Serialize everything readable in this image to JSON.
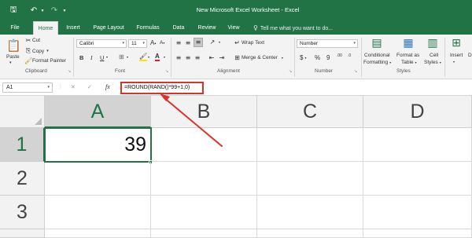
{
  "titlebar": {
    "title": "New Microsoft Excel Worksheet - Excel",
    "qat_icons": [
      "save-icon",
      "undo-icon",
      "redo-icon",
      "customize-icon"
    ]
  },
  "tabs": [
    "File",
    "Home",
    "Insert",
    "Page Layout",
    "Formulas",
    "Data",
    "Review",
    "View"
  ],
  "active_tab": "Home",
  "tell_me": "Tell me what you want to do...",
  "ribbon": {
    "clipboard": {
      "paste": "Paste",
      "cut": "Cut",
      "copy": "Copy",
      "format_painter": "Format Painter",
      "group": "Clipboard"
    },
    "font": {
      "font_name": "Calibri",
      "font_size": "11",
      "bold": "B",
      "italic": "I",
      "underline": "U",
      "grow": "A",
      "shrink": "A",
      "font_color": "A",
      "group": "Font"
    },
    "alignment": {
      "wrap_text": "Wrap Text",
      "merge_center": "Merge & Center",
      "group": "Alignment"
    },
    "number": {
      "format": "Number",
      "currency": "$",
      "percent": "%",
      "comma": "9",
      "inc_dec": ".00",
      "dec_dec": ".0",
      "group": "Number"
    },
    "styles": {
      "conditional_1": "Conditional",
      "conditional_2": "Formatting",
      "format_table_1": "Format as",
      "format_table_2": "Table",
      "cell_styles_1": "Cell",
      "cell_styles_2": "Styles",
      "group": "Styles"
    },
    "cells": {
      "insert": "Insert",
      "delete_partial": "D"
    }
  },
  "formula_bar": {
    "name_box": "A1",
    "cancel": "✕",
    "enter": "✓",
    "fx": "fx",
    "formula": "=ROUND(RAND()*99+1,0)"
  },
  "grid": {
    "columns": [
      "A",
      "B",
      "C",
      "D"
    ],
    "rows": [
      "1",
      "2",
      "3"
    ],
    "selected_cell": "A1",
    "cells": {
      "A1": "39"
    }
  },
  "colors": {
    "excel_green": "#217346",
    "highlight_red": "#d9322a"
  }
}
